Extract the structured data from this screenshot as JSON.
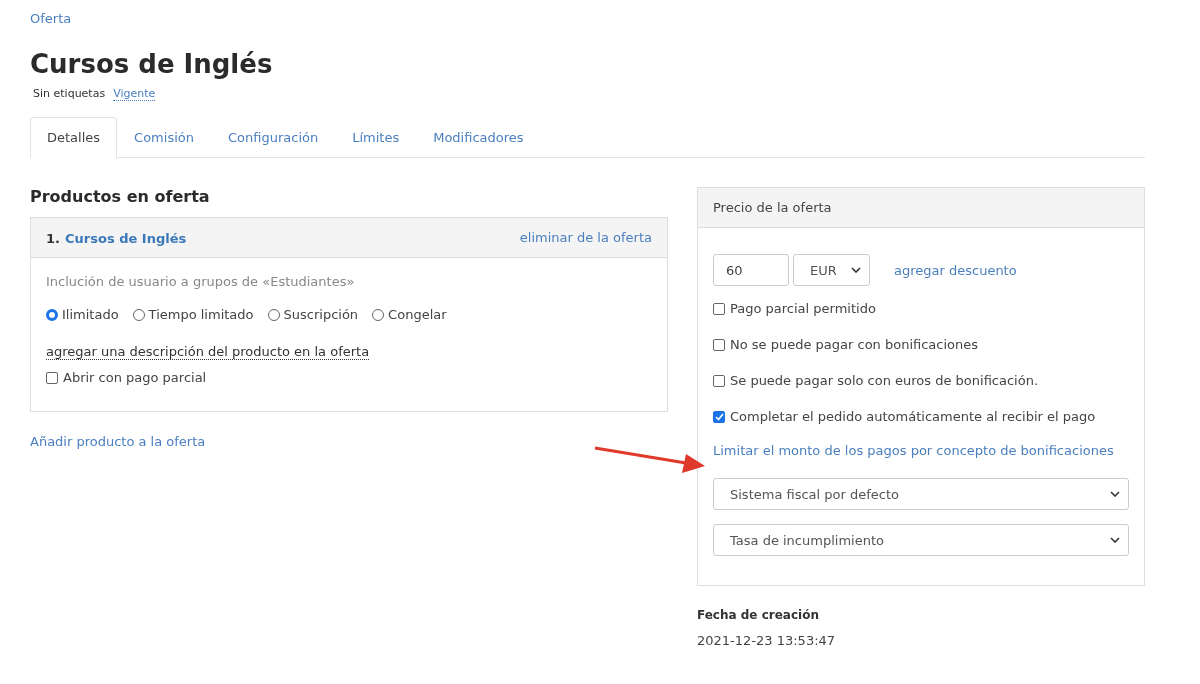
{
  "breadcrumb": "Oferta",
  "title": "Cursos de Inglés",
  "tags_label": "Sin etiquetas",
  "status_link": "Vigente",
  "tabs": [
    {
      "label": "Detalles",
      "selected": true
    },
    {
      "label": "Comisión",
      "selected": false
    },
    {
      "label": "Configuración",
      "selected": false
    },
    {
      "label": "Límites",
      "selected": false
    },
    {
      "label": "Modificadores",
      "selected": false
    }
  ],
  "products": {
    "heading": "Productos en oferta",
    "items": [
      {
        "number": "1.",
        "name": "Cursos de Inglés",
        "remove_link": "eliminar de la oferta",
        "inclusion": "Inclución de usuario a grupos de «Estudiantes»",
        "access_options": [
          {
            "label": "Ilimitado",
            "selected": true
          },
          {
            "label": "Tiempo limitado",
            "selected": false
          },
          {
            "label": "Suscripción",
            "selected": false
          },
          {
            "label": "Congelar",
            "selected": false
          }
        ],
        "description_link": "agregar una descripción del producto en la oferta",
        "partial_open": {
          "label": "Abrir con pago parcial",
          "checked": false
        }
      }
    ],
    "add_link": "Añadir producto a la oferta"
  },
  "price": {
    "heading": "Precio de la oferta",
    "amount": "60",
    "currency": "EUR",
    "discount_link": "agregar descuento",
    "options": [
      {
        "label": "Pago parcial permitido",
        "checked": false
      },
      {
        "label": "No se puede pagar con bonificaciones",
        "checked": false
      },
      {
        "label": "Se puede pagar solo con euros de bonificación.",
        "checked": false
      },
      {
        "label": "Completar el pedido automáticamente al recibir el pago",
        "checked": true
      }
    ],
    "limit_link": "Limitar el monto de los pagos por concepto de bonificaciones",
    "selects": [
      "Sistema fiscal por defecto",
      "Tasa de incumplimiento"
    ]
  },
  "created": {
    "label": "Fecha de creación",
    "value": "2021-12-23 13:53:47"
  }
}
